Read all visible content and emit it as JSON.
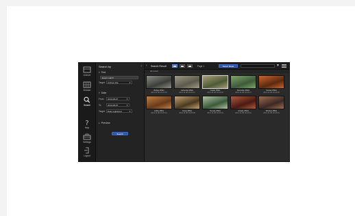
{
  "rail": [
    {
      "label": "Archive",
      "icon": "archive-icon"
    },
    {
      "label": "Browse",
      "icon": "grid-icon"
    },
    {
      "label": "Search",
      "icon": "search-icon"
    },
    {
      "label": "Help",
      "icon": "question-icon"
    },
    {
      "label": "Settings",
      "icon": "toolbox-icon"
    },
    {
      "label": "Logout",
      "icon": "logout-icon"
    }
  ],
  "search_by": {
    "title": "Search by",
    "collapse": "‹",
    "text": {
      "label": "Text",
      "value": "Exact match",
      "target_label": "Target",
      "target_value": "Archive title"
    },
    "date": {
      "label": "Date",
      "from_label": "From",
      "from_value": "2013-08-07",
      "to_label": "To",
      "to_value": "2013-08-07",
      "target_label": "Target",
      "target_value": "Date registered"
    },
    "preview": {
      "label": "Preview"
    },
    "search_button": "Search"
  },
  "results": {
    "back": "‹",
    "title": "Search Result",
    "page_label": "Page 1",
    "select_mode": "Select Mode",
    "filter": "▼",
    "sub_label": "All result",
    "items": [
      {
        "name": "Bridge.JPEG",
        "date": "2013.11.08 10:23:15",
        "c1": "#3c3f3a",
        "c2": "#8b8b80",
        "selected": false
      },
      {
        "name": "cathedral.JPEG",
        "date": "2013.11.08 10:23:41",
        "c1": "#5c5a4b",
        "c2": "#9e9a86",
        "selected": false
      },
      {
        "name": "Castle.JPEG",
        "date": "2013.11.08 10:24:02",
        "c1": "#4e5a34",
        "c2": "#a79f7b",
        "selected": true
      },
      {
        "name": "Riverside.JPEG",
        "date": "2013.11.08 10:24:27",
        "c1": "#3e5a3a",
        "c2": "#7fa66a",
        "selected": false
      },
      {
        "name": "Sunset.JPEG",
        "date": "2013.11.08 10:24:55",
        "c1": "#5a2a10",
        "c2": "#d0632a",
        "selected": false
      },
      {
        "name": "Lobby.JPEG",
        "date": "2013.11.08 10:25:14",
        "c1": "#6a3a1a",
        "c2": "#c08040",
        "selected": false
      },
      {
        "name": "Coast.JPEG",
        "date": "2013.11.08 10:25:38",
        "c1": "#4a3a20",
        "c2": "#c4a070",
        "selected": false
      },
      {
        "name": "Temple.JPEG",
        "date": "2013.11.08 10:26:03",
        "c1": "#3a5a3a",
        "c2": "#b0c0a0",
        "selected": false
      },
      {
        "name": "Arcade.JPEG",
        "date": "2013.11.08 10:26:22",
        "c1": "#4a1a14",
        "c2": "#b05a3a",
        "selected": false
      },
      {
        "name": "Window.JPEG",
        "date": "2013.11.08 10:26:49",
        "c1": "#3a2a24",
        "c2": "#a06a50",
        "selected": false
      }
    ]
  },
  "colors": {
    "accent": "#2e56a8",
    "panel": "#232323",
    "results_bg": "#2a2a2a"
  }
}
